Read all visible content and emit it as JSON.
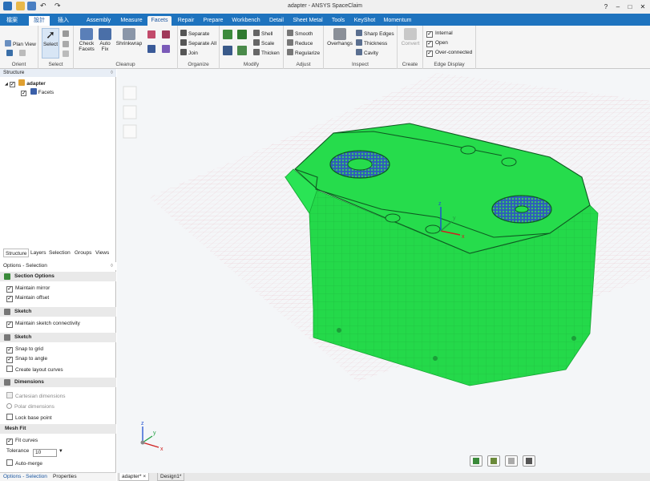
{
  "app": {
    "title": "adapter - ANSYS SpaceClaim"
  },
  "window_controls": {
    "help": "?",
    "minimize": "–",
    "maximize": "□",
    "close": "✕"
  },
  "tabs": [
    "檔案",
    "設計",
    "插入",
    "Assembly",
    "Measure",
    "Facets",
    "Repair",
    "Prepare",
    "Workbench",
    "Detail",
    "Sheet Metal",
    "Tools",
    "KeyShot",
    "Momentum"
  ],
  "active_tab": "Facets",
  "ribbon": {
    "orient": {
      "label": "Orient",
      "plan_view": "Plan View"
    },
    "select": {
      "label": "Select",
      "select_btn": "Select"
    },
    "cleanup": {
      "label": "Cleanup",
      "check_facets": "Check Facets",
      "auto_fix": "Auto Fix",
      "shrinkwrap": "Shrinkwrap"
    },
    "organize": {
      "label": "Organize",
      "separate": "Separate",
      "separate_all": "Separate All",
      "join": "Join"
    },
    "modify": {
      "label": "Modify",
      "shell": "Shell",
      "scale": "Scale",
      "thicken": "Thicken"
    },
    "adjust": {
      "label": "Adjust",
      "smooth": "Smooth",
      "reduce": "Reduce",
      "regularize": "Regularize"
    },
    "inspect": {
      "label": "Inspect",
      "overhangs": "Overhangs",
      "sharp_edges": "Sharp Edges",
      "thickness": "Thickness",
      "cavity": "Cavity"
    },
    "create": {
      "label": "Create",
      "convert": "Convert"
    },
    "edge_display": {
      "label": "Edge Display",
      "internal": "Internal",
      "open": "Open",
      "over_connected": "Over-connected"
    }
  },
  "structure": {
    "header": "Structure",
    "root": "adapter",
    "child": "Facets"
  },
  "panel_tabs": [
    "Structure",
    "Layers",
    "Selection",
    "Groups",
    "Views"
  ],
  "options": {
    "header": "Options - Selection",
    "sections": [
      {
        "title": "Section Options",
        "rows": [
          {
            "label": "Maintain mirror",
            "checked": true
          },
          {
            "label": "Maintain offset",
            "checked": true
          }
        ]
      },
      {
        "title": "Sketch",
        "rows": [
          {
            "label": "Maintain sketch connectivity",
            "checked": true
          }
        ]
      },
      {
        "title": "Sketch",
        "rows": [
          {
            "label": "Snap to grid",
            "checked": true
          },
          {
            "label": "Snap to angle",
            "checked": true
          },
          {
            "label": "Create layout curves",
            "checked": false
          }
        ]
      },
      {
        "title": "Dimensions",
        "rows": [
          {
            "label": "Cartesian dimensions",
            "checked": false
          },
          {
            "label": "Polar dimensions",
            "checked": false
          },
          {
            "label": "Lock base point",
            "checked": false
          }
        ]
      },
      {
        "title": "Mesh Fit",
        "rows": [
          {
            "label": "Fit curves",
            "checked": true
          }
        ]
      }
    ],
    "tolerance_label": "Tolerance",
    "tolerance_value": "10",
    "auto_merge": "Auto-merge"
  },
  "bottom_tabs": [
    "Options - Selection",
    "Properties"
  ],
  "doc_tabs": [
    "adapter*",
    "Design1*"
  ],
  "axis": {
    "x": "x",
    "y": "y",
    "z": "z"
  },
  "colors": {
    "model": "#21e04a",
    "ribbon_tab_bar": "#1e73be",
    "accent": "#1a56a0"
  }
}
